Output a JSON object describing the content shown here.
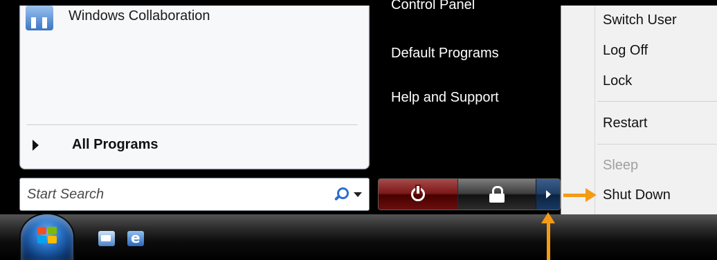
{
  "programs": {
    "pinned_item": "Windows Collaboration",
    "all_programs": "All Programs"
  },
  "search": {
    "placeholder": "Start Search"
  },
  "right_links": {
    "control_panel": "Control Panel",
    "default_programs": "Default Programs",
    "help_support": "Help and Support"
  },
  "power_menu": {
    "items": [
      {
        "label": "Switch User",
        "enabled": true
      },
      {
        "label": "Log Off",
        "enabled": true
      },
      {
        "label": "Lock",
        "enabled": true
      },
      {
        "label": "Restart",
        "enabled": true
      },
      {
        "label": "Sleep",
        "enabled": false
      },
      {
        "label": "Shut Down",
        "enabled": true
      }
    ]
  },
  "icons": {
    "collaboration": "collaboration-icon",
    "search": "search-icon",
    "power": "power-icon",
    "lock": "lock-icon",
    "arrow": "arrow-right-icon",
    "start": "windows-start-icon"
  },
  "colors": {
    "annotation_arrow": "#f49b16",
    "power_button": "#7a1616",
    "arrow_button": "#1e3e66"
  }
}
